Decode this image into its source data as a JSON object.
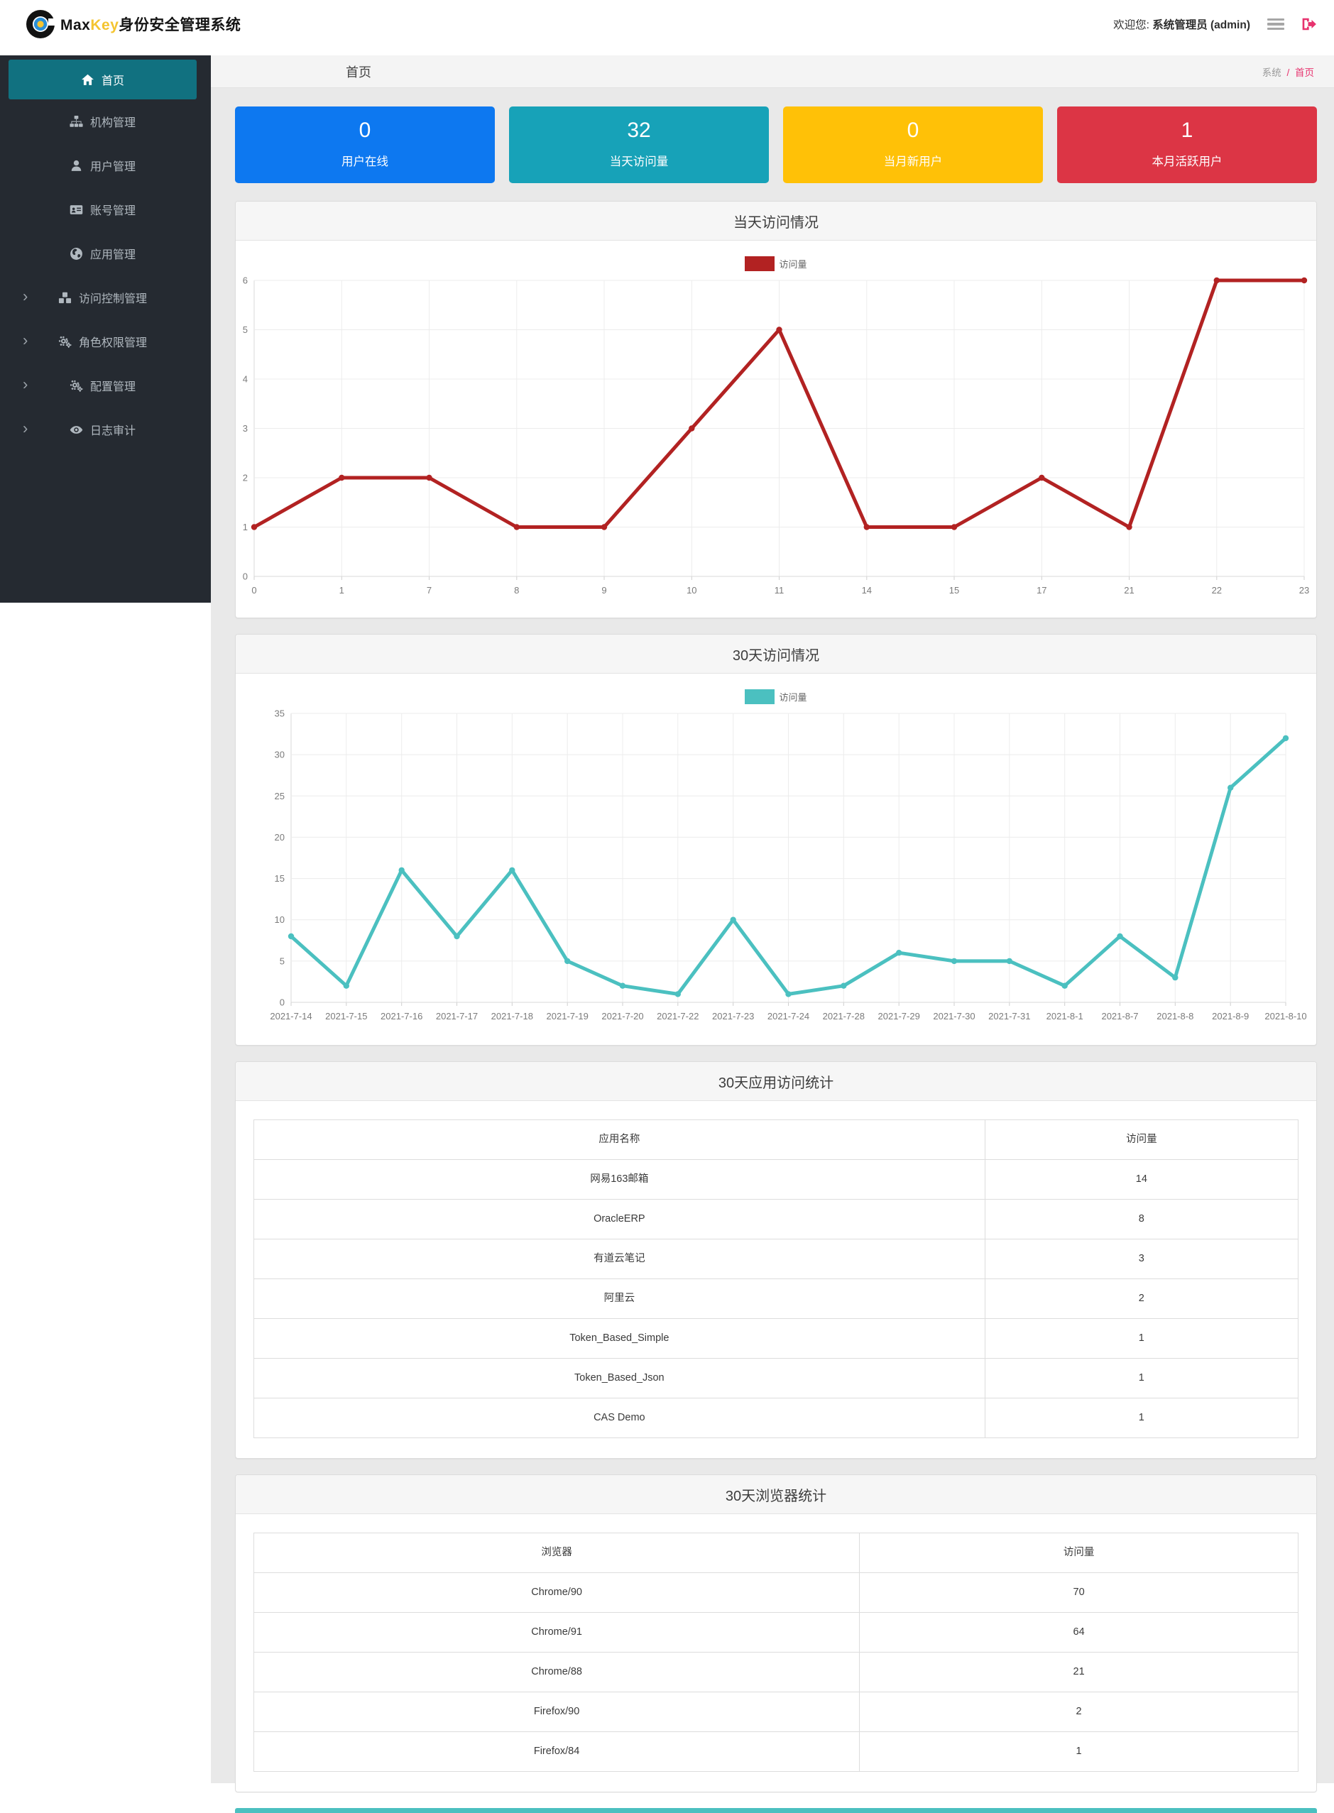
{
  "navbar": {
    "brand_max": "Max",
    "brand_key": "Key",
    "brand_suffix": "身份安全管理系统",
    "welcome_prefix": "欢迎您:",
    "welcome_user": "系统管理员 (admin)"
  },
  "sidebar": {
    "items": [
      {
        "key": "home",
        "label": "首页",
        "icon": "home-icon",
        "active": true,
        "expandable": false
      },
      {
        "key": "org",
        "label": "机构管理",
        "icon": "sitemap-icon",
        "expandable": false
      },
      {
        "key": "user",
        "label": "用户管理",
        "icon": "user-icon",
        "expandable": false
      },
      {
        "key": "account",
        "label": "账号管理",
        "icon": "id-card-icon",
        "expandable": false
      },
      {
        "key": "app",
        "label": "应用管理",
        "icon": "globe-icon",
        "expandable": false
      },
      {
        "key": "access-control",
        "label": "访问控制管理",
        "icon": "cubes-icon",
        "expandable": true
      },
      {
        "key": "role-permission",
        "label": "角色权限管理",
        "icon": "cogs-icon",
        "expandable": true
      },
      {
        "key": "config",
        "label": "配置管理",
        "icon": "cogs-icon",
        "expandable": true
      },
      {
        "key": "log-audit",
        "label": "日志审计",
        "icon": "eye-icon",
        "expandable": true
      }
    ]
  },
  "content_header": {
    "title": "首页",
    "breadcrumb": {
      "root": "系统",
      "separator": "/",
      "current": "首页"
    }
  },
  "stat_cards": [
    {
      "key": "online-users",
      "value": "0",
      "label": "用户在线",
      "color": "#0d78f0"
    },
    {
      "key": "today-visits",
      "value": "32",
      "label": "当天访问量",
      "color": "#17a2b8"
    },
    {
      "key": "month-new-users",
      "value": "0",
      "label": "当月新用户",
      "color": "#ffc107"
    },
    {
      "key": "month-active-users",
      "value": "1",
      "label": "本月活跃用户",
      "color": "#dc3545"
    }
  ],
  "chart_data": [
    {
      "type": "line",
      "title": "当天访问情况",
      "legend_label": "访问量",
      "legend_position": "top",
      "color": "#b22222",
      "grid": true,
      "categories": [
        "0",
        "1",
        "7",
        "8",
        "9",
        "10",
        "11",
        "14",
        "15",
        "17",
        "21",
        "22",
        "23"
      ],
      "values": [
        1,
        2,
        2,
        1,
        1,
        3,
        5,
        1,
        1,
        2,
        1,
        6,
        6
      ],
      "xlabel": "",
      "ylabel": "",
      "ylim": [
        0,
        6
      ],
      "yticks": [
        0,
        1,
        2,
        3,
        4,
        5,
        6
      ]
    },
    {
      "type": "line",
      "title": "30天访问情况",
      "legend_label": "访问量",
      "legend_position": "top",
      "color": "#4bc0c0",
      "grid": true,
      "categories": [
        "2021-7-14",
        "2021-7-15",
        "2021-7-16",
        "2021-7-17",
        "2021-7-18",
        "2021-7-19",
        "2021-7-20",
        "2021-7-22",
        "2021-7-23",
        "2021-7-24",
        "2021-7-28",
        "2021-7-29",
        "2021-7-30",
        "2021-7-31",
        "2021-8-1",
        "2021-8-7",
        "2021-8-8",
        "2021-8-9",
        "2021-8-10"
      ],
      "values": [
        8,
        2,
        16,
        8,
        16,
        5,
        2,
        1,
        10,
        1,
        2,
        6,
        5,
        5,
        2,
        8,
        3,
        26,
        32
      ],
      "xlabel": "",
      "ylabel": "",
      "ylim": [
        0,
        35
      ],
      "yticks": [
        0,
        5,
        10,
        15,
        20,
        25,
        30,
        35
      ]
    }
  ],
  "tables": [
    {
      "title": "30天应用访问统计",
      "headers": [
        "应用名称",
        "访问量"
      ],
      "rows": [
        [
          "网易163邮箱",
          "14"
        ],
        [
          "OracleERP",
          "8"
        ],
        [
          "有道云笔记",
          "3"
        ],
        [
          "阿里云",
          "2"
        ],
        [
          "Token_Based_Simple",
          "1"
        ],
        [
          "Token_Based_Json",
          "1"
        ],
        [
          "CAS Demo",
          "1"
        ]
      ]
    },
    {
      "title": "30天浏览器统计",
      "headers": [
        "浏览器",
        "访问量"
      ],
      "rows": [
        [
          "Chrome/90",
          "70"
        ],
        [
          "Chrome/91",
          "64"
        ],
        [
          "Chrome/88",
          "21"
        ],
        [
          "Firefox/90",
          "2"
        ],
        [
          "Firefox/84",
          "1"
        ]
      ]
    }
  ],
  "theme": {
    "breadcrumb_accent": "#e7326e",
    "sidebar_active_bg": "#117180",
    "logout_icon_color": "#e7326e",
    "bottom_strip_color": "#4bc0c0"
  }
}
